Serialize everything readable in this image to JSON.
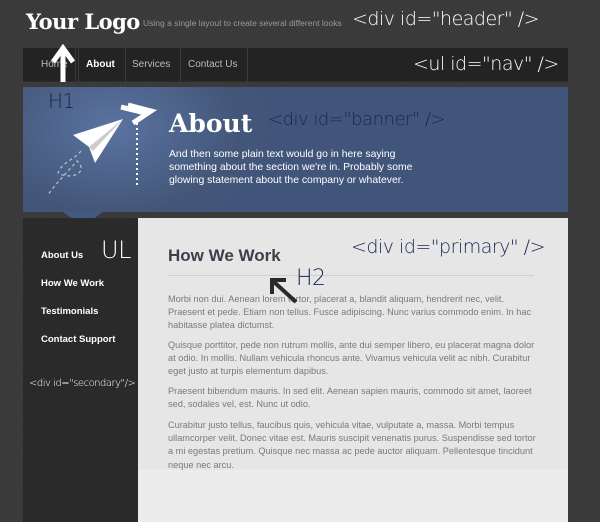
{
  "header": {
    "logo": "Your Logo",
    "tagline": "Using a single layout to create several different looks",
    "annotation": "<div id=\"header\" />"
  },
  "nav": {
    "items": [
      {
        "label": "Home"
      },
      {
        "label": "About",
        "active": true
      },
      {
        "label": "Services"
      },
      {
        "label": "Contact Us"
      }
    ],
    "annotation": "<ul id=\"nav\" />"
  },
  "banner": {
    "title": "About",
    "text": "And then some plain text would go in here saying something about the section we're in. Probably some glowing statement about the company or whatever.",
    "annotation": "<div id=\"banner\" />",
    "h1_annotation": "H1",
    "color": "#44597e"
  },
  "secondary": {
    "items": [
      {
        "label": "About Us"
      },
      {
        "label": "How We Work"
      },
      {
        "label": "Testimonials"
      },
      {
        "label": "Contact Support"
      }
    ],
    "ul_annotation": "UL",
    "annotation": "<div id=\"secondary\"/>"
  },
  "primary": {
    "heading": "How We Work",
    "h2_annotation": "H2",
    "annotation": "<div id=\"primary\" />",
    "paragraphs": [
      "Morbi non dui. Aenean lorem tortor, placerat a, blandit aliquam, hendrerit nec, velit. Praesent et pede. Etiam non tellus. Fusce adipiscing. Nunc varius commodo enim. In hac habitasse platea dictumst.",
      "Quisque porttitor, pede non rutrum mollis, ante dui semper libero, eu placerat magna dolor at odio. In mollis. Nullam vehicula rhoncus ante. Vivamus vehicula velit ac nibh. Curabitur eget justo at turpis elementum dapibus.",
      "Praesent bibendum mauris. In sed elit. Aenean sapien mauris, commodo sit amet, laoreet sed, sodales vel, est. Nunc ut odio.",
      "Curabitur justo tellus, faucibus quis, vehicula vitae, vulputate a, massa. Morbi tempus ullamcorper velit. Donec vitae est. Mauris suscipit venenatis purus. Suspendisse sed tortor a mi egestas pretium. Quisque nec massa ac pede auctor aliquam. Pellentesque tincidunt neque nec arcu."
    ]
  }
}
